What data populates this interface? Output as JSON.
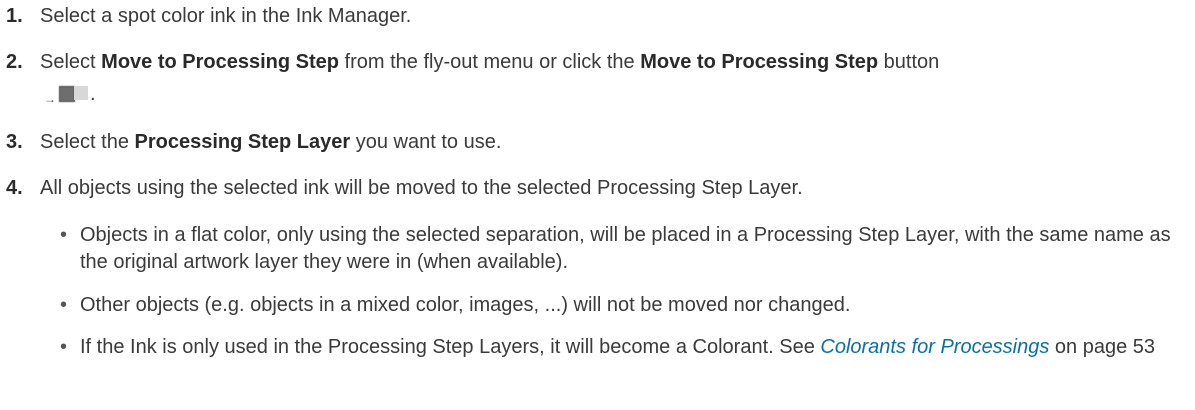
{
  "steps": [
    {
      "number": "1.",
      "text": "Select a spot color ink in the Ink Manager."
    },
    {
      "number": "2.",
      "pre": "Select ",
      "b1": "Move to Processing Step",
      "mid": " from the fly-out menu or click the ",
      "b2": "Move to Processing Step",
      "post": " button",
      "icon": "move-to-processing-step-icon",
      "trailing": "."
    },
    {
      "number": "3.",
      "pre": "Select the ",
      "b1": "Processing Step Layer",
      "post": " you want to use."
    },
    {
      "number": "4.",
      "text": "All objects using the selected ink will be moved to the selected Processing Step Layer."
    }
  ],
  "bullets": [
    {
      "text": "Objects in a flat color, only using the selected separation, will be placed in a Processing Step Layer, with the same name as the original artwork layer they were in (when available)."
    },
    {
      "text": "Other objects (e.g. objects in a mixed color, images, ...) will not be moved nor changed."
    },
    {
      "pre": "If the Ink is only used in the Processing Step Layers, it will become a Colorant. See ",
      "link": "Colorants for Processings",
      "post": " on page 53"
    }
  ],
  "colors": {
    "text": "#3a3a3a",
    "link": "#0a6fa8"
  }
}
